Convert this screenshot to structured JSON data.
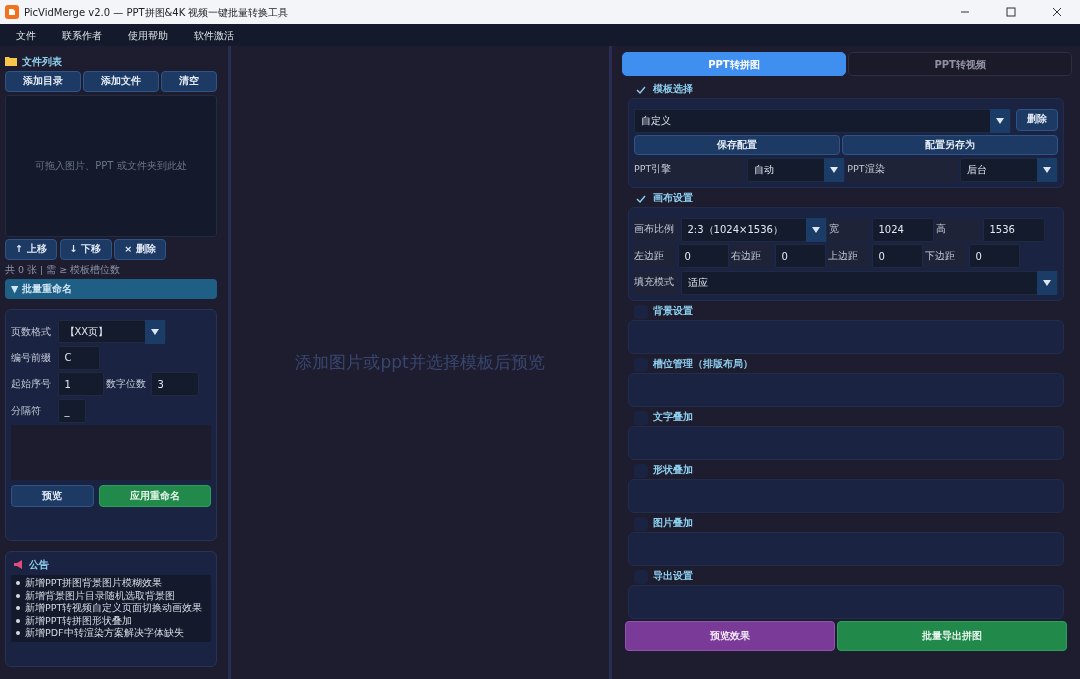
{
  "window": {
    "title": "PicVidMerge v2.0 — PPT拼图&4K 视频一键批量转换工具"
  },
  "menu": [
    "文件",
    "联系作者",
    "使用帮助",
    "软件激活"
  ],
  "file_panel": {
    "title": "文件列表",
    "buttons": [
      "添加目录",
      "添加文件",
      "清空"
    ],
    "drop_hint": "可拖入图片、PPT 或文件夹到此处",
    "move_buttons": [
      {
        "icon": "↑",
        "label": "上移"
      },
      {
        "icon": "↓",
        "label": "下移"
      },
      {
        "icon": "×",
        "label": "删除"
      }
    ],
    "count_text": "共 0 张 | 需 ≥ 模板槽位数"
  },
  "rename": {
    "arrow": "▼",
    "title": "批量重命名",
    "expanded": true,
    "page_format": {
      "label": "页数格式",
      "value": "【XX页】"
    },
    "prefix": {
      "label": "编号前缀",
      "value": "C"
    },
    "start": {
      "label": "起始序号",
      "value": "1"
    },
    "digits": {
      "label": "数字位数",
      "value": "3"
    },
    "separator": {
      "label": "分隔符",
      "value": "_"
    },
    "buttons": [
      {
        "label": "预览",
        "kind": "secondary"
      },
      {
        "label": "应用重命名",
        "kind": "success"
      }
    ]
  },
  "notice": {
    "title": "公告",
    "items": [
      "新增PPT拼图背景图片模糊效果",
      "新增背景图片目录随机选取背景图",
      "新增PPT转视频自定义页面切换动画效果",
      "新增PPT转拼图形状叠加",
      "新增PDF中转渲染方案解决字体缺失"
    ]
  },
  "preview": {
    "placeholder": "添加图片或ppt并选择模板后预览"
  },
  "tabs": [
    {
      "label": "PPT转拼图",
      "selected": true
    },
    {
      "label": "PPT转视频",
      "selected": false
    }
  ],
  "template": {
    "title": "模板选择",
    "checked": true,
    "value": "自定义",
    "delete_button": "删除",
    "save_button": "保存配置",
    "save_as_button": "配置另存为",
    "engine": {
      "label": "PPT引擎",
      "value": "自动"
    },
    "render": {
      "label": "PPT渲染",
      "value": "后台"
    }
  },
  "canvas": {
    "title": "画布设置",
    "checked": true,
    "ratio": {
      "label": "画布比例",
      "value": "2:3（1024×1536）"
    },
    "width": {
      "label": "宽",
      "value": "1024"
    },
    "height": {
      "label": "高",
      "value": "1536"
    },
    "margins": [
      {
        "label": "左边距",
        "value": "0"
      },
      {
        "label": "右边距",
        "value": "0"
      },
      {
        "label": "上边距",
        "value": "0"
      },
      {
        "label": "下边距",
        "value": "0"
      }
    ],
    "fill_mode": {
      "label": "填充模式",
      "value": "适应"
    }
  },
  "sections": [
    {
      "title": "背景设置",
      "checked": false
    },
    {
      "title": "槽位管理（排版布局）",
      "checked": false
    },
    {
      "title": "文字叠加",
      "checked": false
    },
    {
      "title": "形状叠加",
      "checked": false
    },
    {
      "title": "图片叠加",
      "checked": false
    },
    {
      "title": "导出设置",
      "checked": false
    }
  ],
  "actions": [
    {
      "label": "预览效果",
      "kind": "purple"
    },
    {
      "label": "批量导出拼图",
      "kind": "success"
    }
  ]
}
